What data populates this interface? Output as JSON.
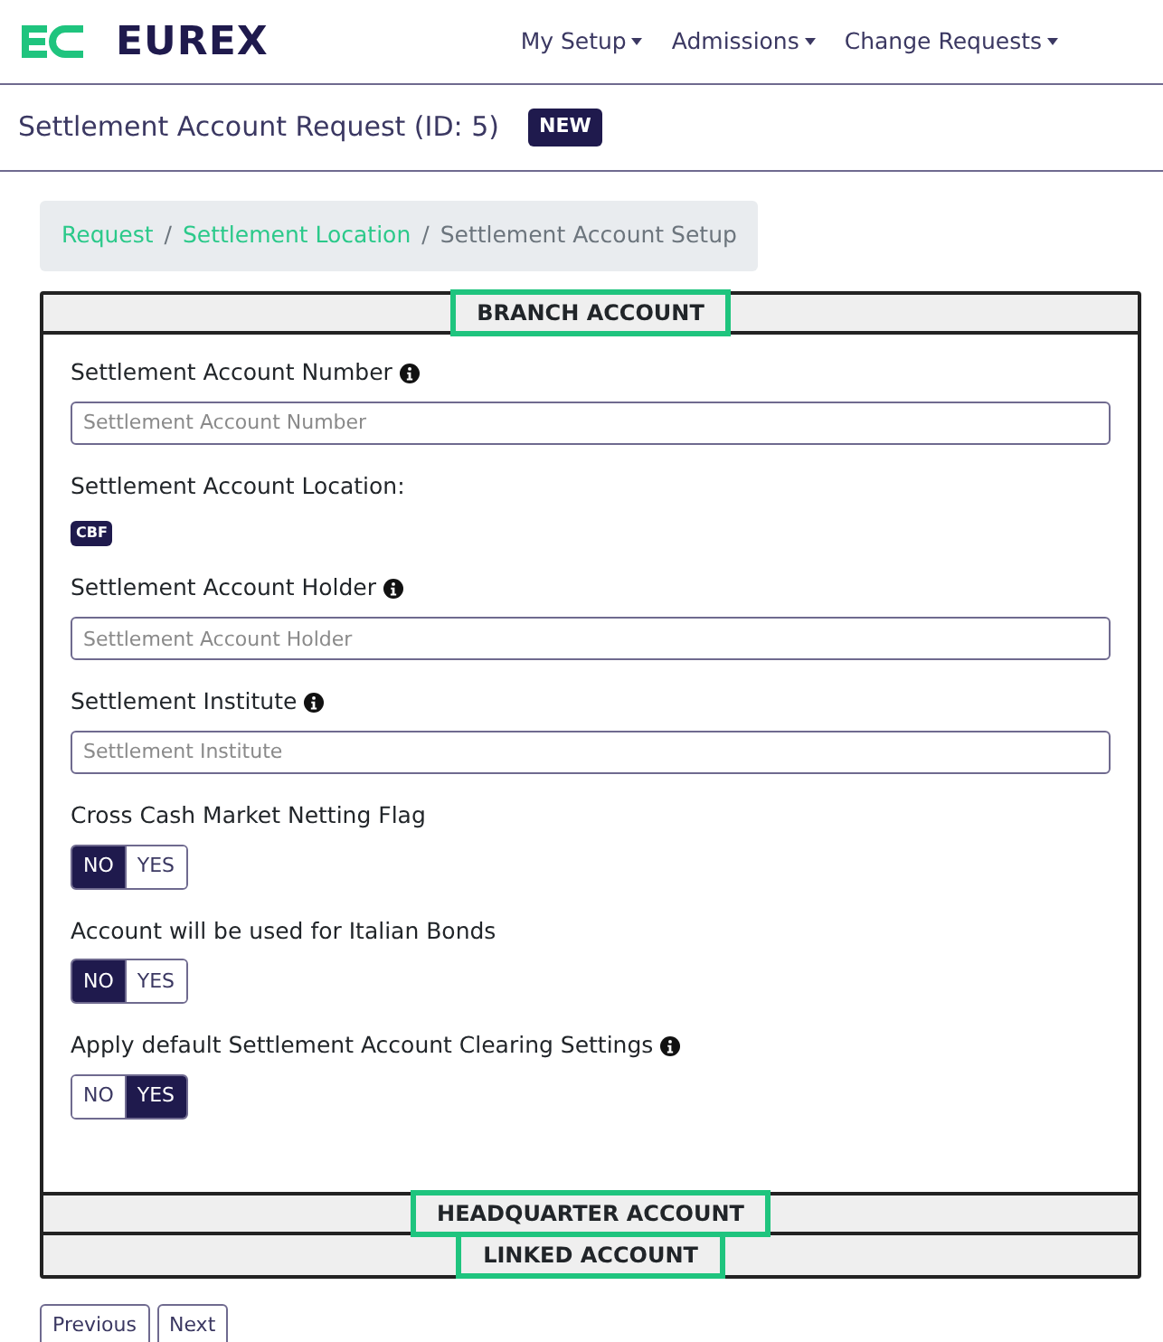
{
  "brand": {
    "name": "EUREX"
  },
  "nav": [
    {
      "label": "My Setup"
    },
    {
      "label": "Admissions"
    },
    {
      "label": "Change Requests"
    }
  ],
  "page_title": {
    "text": "Settlement Account Request (ID: 5)",
    "badge": "NEW"
  },
  "breadcrumb": [
    {
      "label": "Request",
      "link": true
    },
    {
      "separator": "/",
      "label": "Settlement Location",
      "link": true
    },
    {
      "separator": "/",
      "label": "Settlement Account Setup",
      "link": false
    }
  ],
  "sections": [
    {
      "title": "BRANCH ACCOUNT",
      "highlighted": true,
      "expanded": true,
      "fields": [
        {
          "kind": "input",
          "label": "Settlement Account Number",
          "info": true,
          "placeholder": "Settlement Account Number"
        },
        {
          "kind": "badge",
          "label": "Settlement Account Location:",
          "info": false,
          "value": "CBF"
        },
        {
          "kind": "input",
          "label": "Settlement Account Holder",
          "info": true,
          "placeholder": "Settlement Account Holder"
        },
        {
          "kind": "input",
          "label": "Settlement Institute",
          "info": true,
          "placeholder": "Settlement Institute"
        },
        {
          "kind": "toggle",
          "label": "Cross Cash Market Netting Flag",
          "info": false,
          "options": [
            {
              "label": "NO",
              "selected": true
            },
            {
              "label": "YES",
              "selected": false
            }
          ]
        },
        {
          "kind": "toggle",
          "label": "Account will be used for Italian Bonds",
          "info": false,
          "options": [
            {
              "label": "NO",
              "selected": true
            },
            {
              "label": "YES",
              "selected": false
            }
          ]
        },
        {
          "kind": "toggle",
          "label": "Apply default Settlement Account Clearing Settings",
          "info": true,
          "options": [
            {
              "label": "NO",
              "selected": false
            },
            {
              "label": "YES",
              "selected": true
            }
          ]
        }
      ]
    },
    {
      "title": "HEADQUARTER ACCOUNT",
      "highlighted": true,
      "expanded": false
    },
    {
      "title": "LINKED ACCOUNT",
      "highlighted": true,
      "expanded": false
    }
  ],
  "buttons": [
    {
      "label": "Previous"
    },
    {
      "label": "Next"
    }
  ]
}
